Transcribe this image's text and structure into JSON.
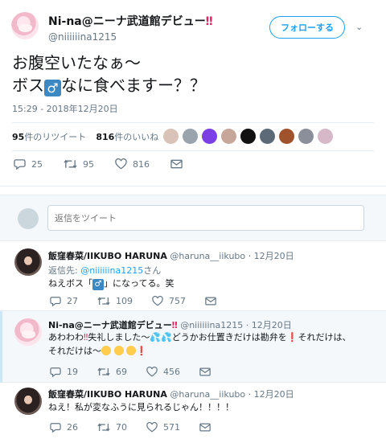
{
  "tweet": {
    "name": "Ni-na@ニーナ武道館デビュー",
    "name_bang": "‼",
    "handle": "@niiiiiina1215",
    "follow_label": "フォローする",
    "caret": "⌄",
    "text_line1": "お腹空いたなぁ～",
    "text_line2a": "ボス",
    "male_sign": "♂",
    "text_line2b": "なに食べますー？？",
    "time": "15:29 - 2018年12月20日",
    "retweets_num": "95",
    "retweets_label": "件のリツイート",
    "likes_num": "816",
    "likes_label": "件のいいね",
    "reply_count": "25",
    "retweet_count": "95",
    "like_count": "816",
    "liker_colors": [
      "#d9c2b8",
      "#9aa4ad",
      "#7b3fe4",
      "#c8a79b",
      "#111111",
      "#5c6a78",
      "#a0522d",
      "#8a8f99",
      "#d6b8c8"
    ]
  },
  "reply_box": {
    "placeholder": "返信をツイート"
  },
  "replies": [
    {
      "name": "飯窪春菜/IIKUBO HARUNA",
      "handle": "@haruna__iikubo",
      "date": "12月20日",
      "reply_to_label": "返信先:",
      "reply_to_handle": "@niiiiiina1215",
      "reply_to_suffix": "さん",
      "text_a": "ねえボス「",
      "text_male": "♂",
      "text_b": "」になってる。笑",
      "replies": "27",
      "retweets": "109",
      "likes": "757"
    },
    {
      "name": "Ni-na@ニーナ武道館デビュー",
      "name_bang": "‼",
      "handle": "@niiiiiina1215",
      "date": "12月20日",
      "text_a": "あわわわ",
      "text_bang": "‼",
      "text_b": "失礼しました〜",
      "text_drops": "💦💦",
      "text_c": "どうかお仕置きだけは勘弁を",
      "text_ex": "❗",
      "text_d": "それだけは、",
      "text_e": "それだけは〜",
      "text_ex2": "❗",
      "replies": "19",
      "retweets": "69",
      "likes": "456"
    },
    {
      "name": "飯窪春菜/IIKUBO HARUNA",
      "handle": "@haruna__iikubo",
      "date": "12月20日",
      "text": "ねえ！私が変なふうに見られるじゃん！！！！",
      "replies": "26",
      "retweets": "70",
      "likes": "571"
    }
  ]
}
